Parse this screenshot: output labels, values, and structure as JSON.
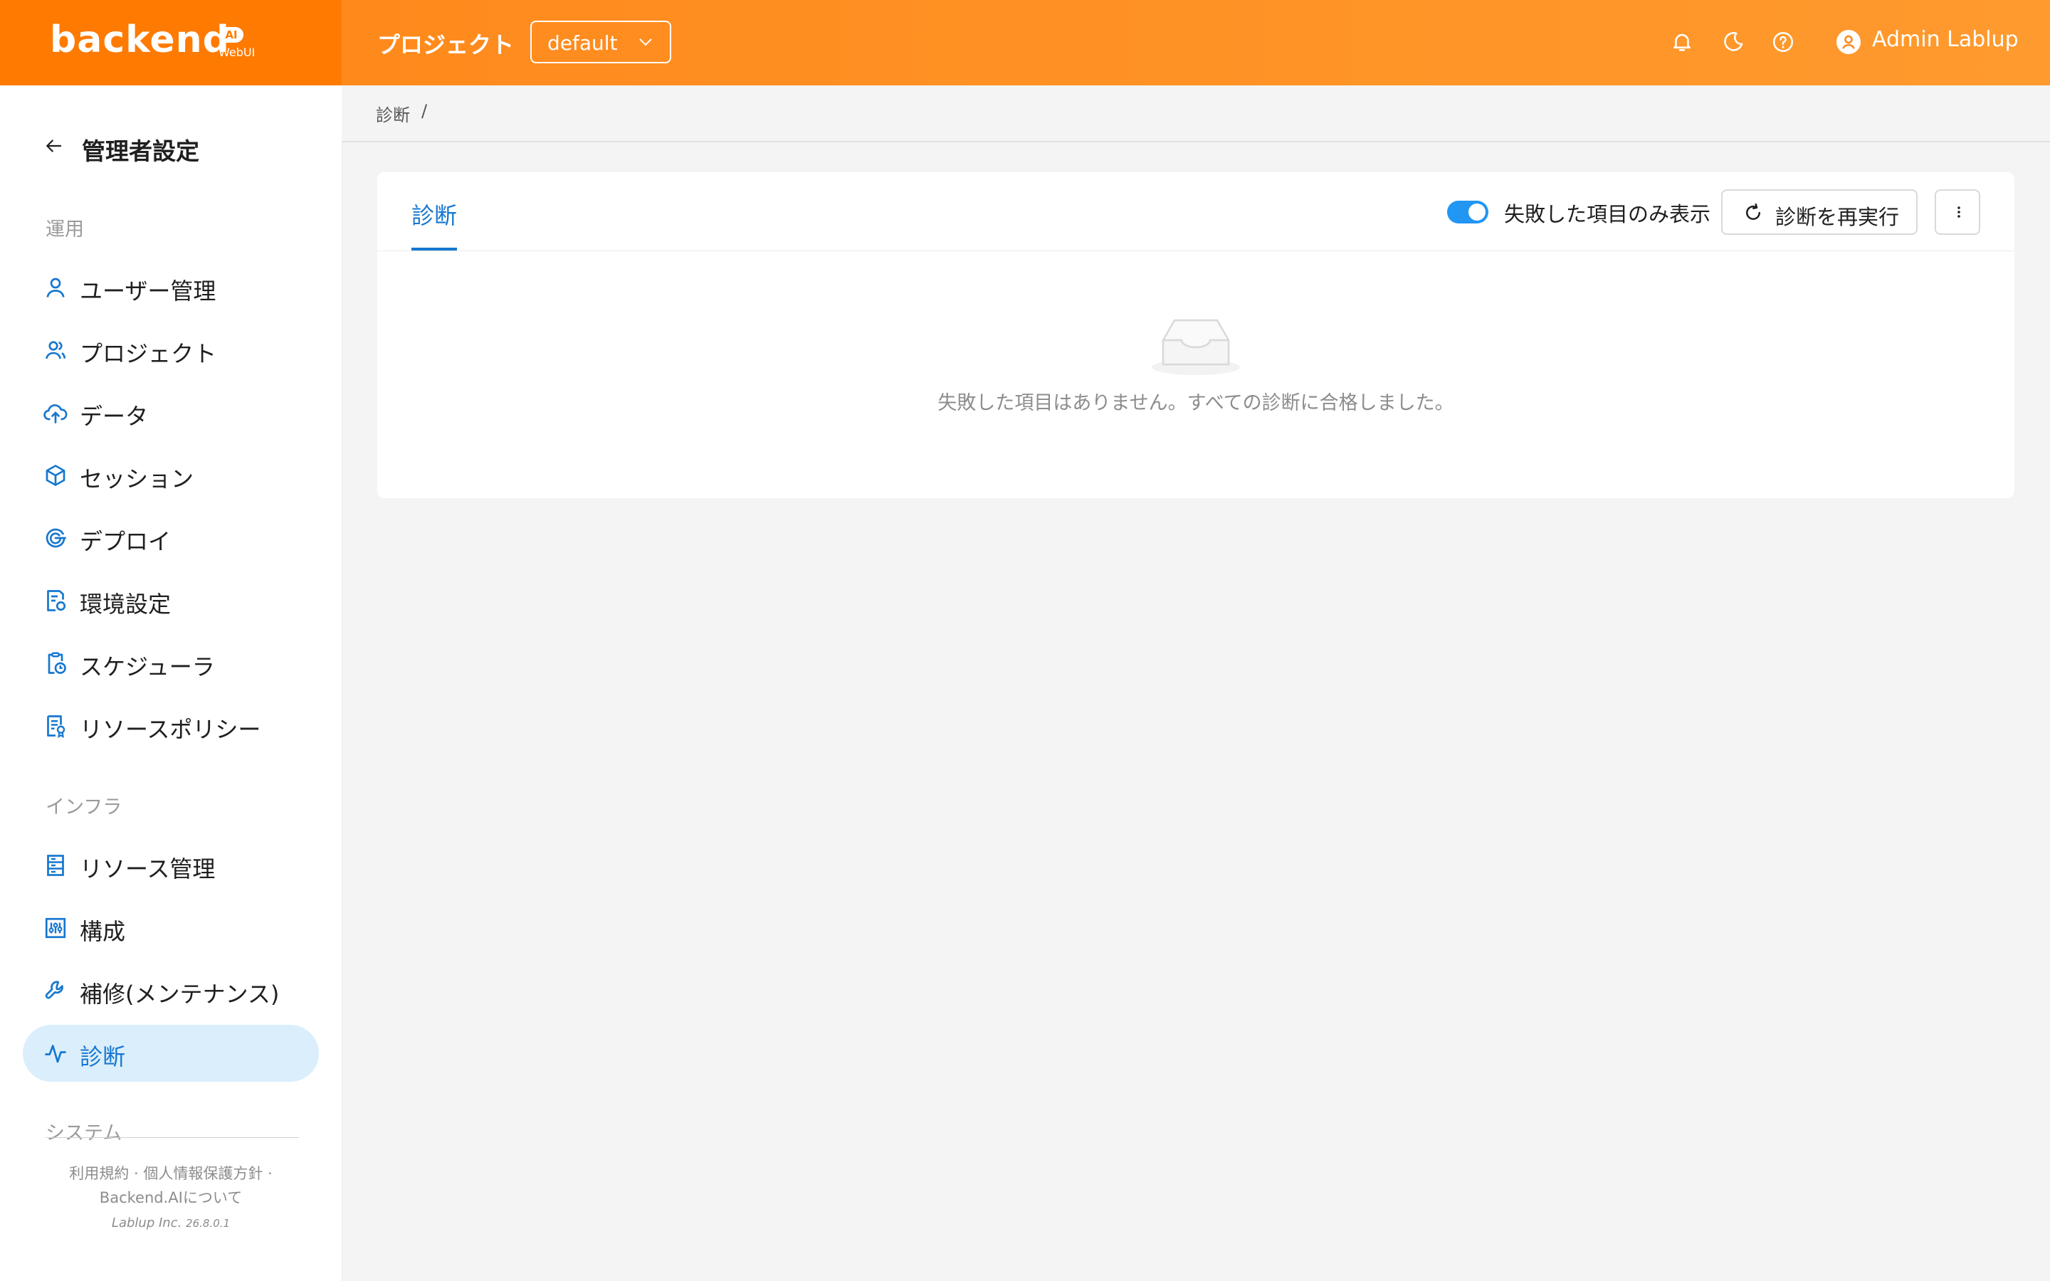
{
  "header": {
    "logo_text": "backend",
    "logo_badge": "AI",
    "logo_sub": "WebUI",
    "project_label": "プロジェクト",
    "project_value": "default",
    "user_name": "Admin Lablup"
  },
  "sidebar": {
    "title": "管理者設定",
    "groups": {
      "operations": "運用",
      "infra": "インフラ",
      "system": "システム"
    },
    "items": [
      {
        "label": "ユーザー管理",
        "icon": "user-icon"
      },
      {
        "label": "プロジェクト",
        "icon": "team-icon"
      },
      {
        "label": "データ",
        "icon": "cloud-upload-icon"
      },
      {
        "label": "セッション",
        "icon": "cube-icon"
      },
      {
        "label": "デプロイ",
        "icon": "deploy-icon"
      },
      {
        "label": "環境設定",
        "icon": "file-settings-icon"
      },
      {
        "label": "スケジューラ",
        "icon": "clipboard-clock-icon"
      },
      {
        "label": "リソースポリシー",
        "icon": "document-badge-icon"
      },
      {
        "label": "リソース管理",
        "icon": "server-icon"
      },
      {
        "label": "構成",
        "icon": "sliders-icon"
      },
      {
        "label": "補修(メンテナンス)",
        "icon": "wrench-icon"
      },
      {
        "label": "診断",
        "icon": "pulse-icon"
      }
    ],
    "footer": {
      "links_line1": "利用規約 · 個人情報保護方針 ·",
      "links_line2": "Backend.AIについて",
      "company": "Lablup Inc.",
      "version": "26.8.0.1"
    }
  },
  "breadcrumb": {
    "current": "診断",
    "separator": "/"
  },
  "card": {
    "tab": "診断",
    "toggle_label": "失敗した項目のみ表示",
    "toggle_on": true,
    "rerun_button": "診断を再実行",
    "empty_message": "失敗した項目はありません。すべての診断に合格しました。"
  },
  "colors": {
    "header_start": "#ff7a00",
    "header_end": "#ff9a2e",
    "accent": "#1677cf",
    "active_bg": "#dbeefc",
    "toggle": "#2196f3"
  }
}
